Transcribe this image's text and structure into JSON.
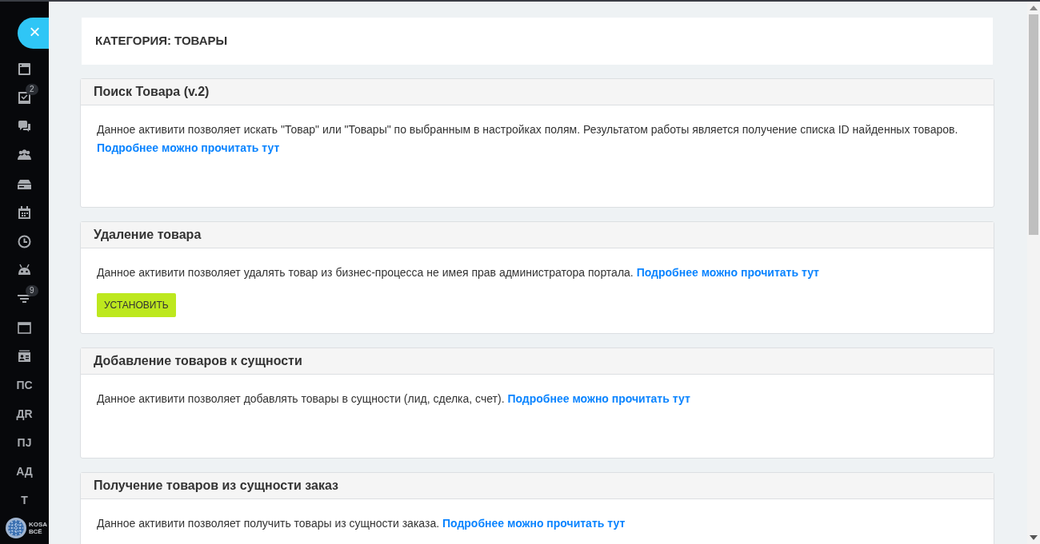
{
  "sidebar": {
    "close_button": "×",
    "items": [
      {
        "kind": "icon"
      },
      {
        "kind": "icon",
        "badge": "2"
      },
      {
        "kind": "icon"
      },
      {
        "kind": "icon"
      },
      {
        "kind": "icon"
      },
      {
        "kind": "icon"
      },
      {
        "kind": "icon"
      },
      {
        "kind": "icon"
      },
      {
        "kind": "icon",
        "badge": "9"
      },
      {
        "kind": "icon"
      },
      {
        "kind": "icon"
      },
      {
        "kind": "text",
        "label": "ПС"
      },
      {
        "kind": "text",
        "label": "ДR"
      },
      {
        "kind": "text",
        "label": "ПJ"
      },
      {
        "kind": "text",
        "label": "АД"
      },
      {
        "kind": "text",
        "label": "Т"
      }
    ],
    "logo_lines": [
      "KOSA",
      "ВСЁ"
    ]
  },
  "category_title": "КАТЕГОРИЯ: ТОВАРЫ",
  "activities": [
    {
      "title": "Поиск Товара (v.2)",
      "description": "Данное активити позволяет искать \"Товар\" или \"Товары\" по выбранным в настройках полям. Результатом работы является получение списка ID найденных товаров.",
      "link": "Подробнее можно прочитать тут"
    },
    {
      "title": "Удаление товара",
      "description": "Данное активити позволяет удалять товар из бизнес-процесса не имея прав администратора портала.",
      "link": "Подробнее можно прочитать тут",
      "button": "УСТАНОВИТЬ"
    },
    {
      "title": "Добавление товаров к сущности",
      "description": "Данное активити позволяет добавлять товары в сущности (лид, сделка, счет).",
      "link": "Подробнее можно прочитать тут"
    },
    {
      "title": "Получение товаров из сущности заказ",
      "description": "Данное активити позволяет получить товары из сущности заказа.",
      "link": "Подробнее можно прочитать тут"
    }
  ]
}
